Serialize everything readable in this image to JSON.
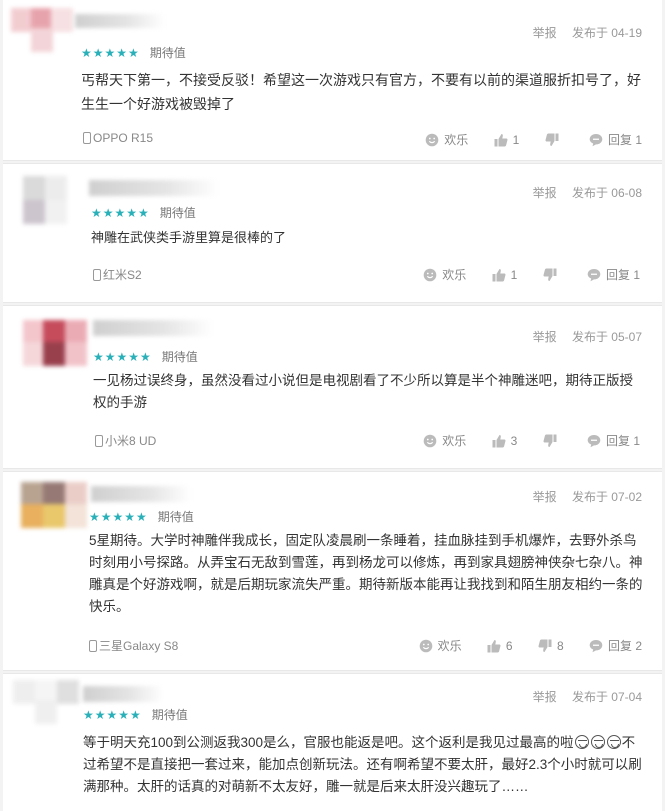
{
  "labels": {
    "report": "举报",
    "joy": "欢乐",
    "reply": "回复"
  },
  "colors": {
    "star": "#29b0b8",
    "text": "#333333",
    "meta": "#999999"
  },
  "reviews": [
    {
      "stars": "★★★★★",
      "tag": "期待值",
      "published": "发布于 04-19",
      "content": "丐帮天下第一，不接受反驳！希望这一次游戏只有官方，不要有以前的渠道服折扣号了，好生生一个好游戏被毁掉了",
      "device": "OPPO R15",
      "likes": "1",
      "dislikes": "",
      "replies": "回复 1"
    },
    {
      "stars": "★★★★★",
      "tag": "期待值",
      "published": "发布于 06-08",
      "content": "神雕在武侠类手游里算是很棒的了",
      "device": "红米S2",
      "likes": "1",
      "dislikes": "",
      "replies": "回复 1"
    },
    {
      "stars": "★★★★★",
      "tag": "期待值",
      "published": "发布于 05-07",
      "content": "一见杨过误终身，虽然没看过小说但是电视剧看了不少所以算是半个神雕迷吧，期待正版授权的手游",
      "device": "小米8 UD",
      "likes": "3",
      "dislikes": "",
      "replies": "回复 1"
    },
    {
      "stars": "★★★★★",
      "tag": "期待值",
      "published": "发布于 07-02",
      "content": "5星期待。大学时神雕伴我成长，固定队凌晨刷一条睡着，挂血脉挂到手机爆炸，去野外杀鸟时刻用小号探路。从弄宝石无敌到雪莲，再到杨龙可以修炼，再到家具翅膀神侠杂七杂八。神雕真是个好游戏啊，就是后期玩家流失严重。期待新版本能再让我找到和陌生朋友相约一条的快乐。",
      "device": "三星Galaxy S8",
      "likes": "6",
      "dislikes": "8",
      "replies": "回复 2"
    },
    {
      "stars": "★★★★★",
      "tag": "期待值",
      "published": "发布于 07-04",
      "content_a": "等于明天充100到公测返我300是么，官服也能返是吧。这个返利是我见过最高的啦",
      "content_b": "不过希望不是直接把一套过来，能加点创新玩法。还有啊希望不要太肝，最好2.3个小时就可以刷满那种。太肝的话真的对萌新不太友好，雕一就是后来太肝没兴趣玩了……"
    }
  ]
}
